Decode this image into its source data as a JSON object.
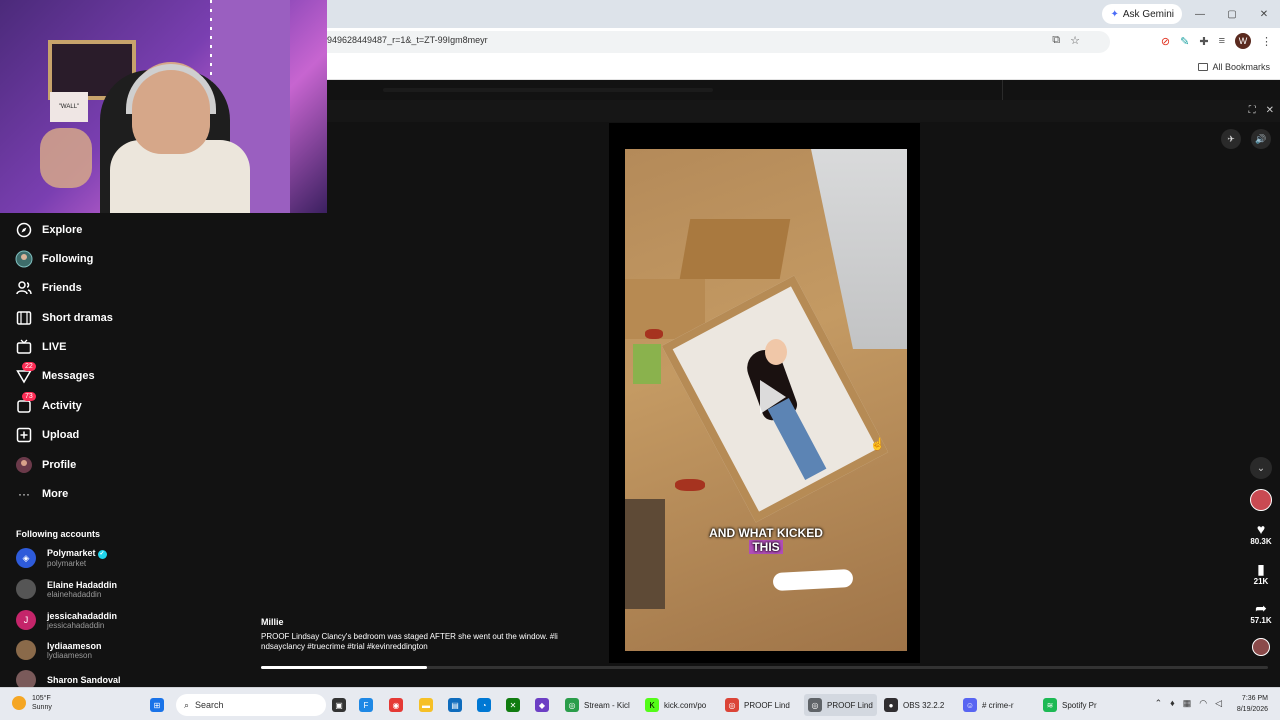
{
  "browser": {
    "ask_gemini": "Ask Gemini",
    "address": "949628449487_r=1&_t=ZT-99Igm8meyr",
    "all_bookmarks": "All Bookmarks",
    "profile_initial": "W"
  },
  "sidebar": {
    "nav": [
      {
        "label": "Explore"
      },
      {
        "label": "Following"
      },
      {
        "label": "Friends"
      },
      {
        "label": "Short dramas"
      },
      {
        "label": "LIVE"
      },
      {
        "label": "Messages",
        "badge": "22"
      },
      {
        "label": "Activity",
        "badge": "73"
      },
      {
        "label": "Upload"
      },
      {
        "label": "Profile"
      },
      {
        "label": "More"
      }
    ],
    "following_title": "Following accounts",
    "accounts": [
      {
        "name": "Polymarket",
        "handle": "polymarket",
        "color": "#2e5bda"
      },
      {
        "name": "Elaine Hadaddin",
        "handle": "elainehadaddin",
        "color": "#555555"
      },
      {
        "name": "jessicahadaddin",
        "handle": "jessicahadaddin",
        "color": "#c4256a",
        "initial": "J"
      },
      {
        "name": "lydiaameson",
        "handle": "lydiaameson",
        "color": "#8a6a4a"
      },
      {
        "name": "Sharon Sandoval",
        "handle": "",
        "color": "#7a5a5a"
      }
    ]
  },
  "video": {
    "caption_line1": "AND WHAT KICKED",
    "caption_line2": "THIS",
    "author": "Millie",
    "description": "PROOF Lindsay Clancy's bedroom was staged AFTER she went out the window. #li ndsayclancy #truecrime #trial #kevinreddington",
    "progress": 0.165
  },
  "actions": {
    "likes": "80.3K",
    "saves": "21K",
    "shares": "57.1K"
  },
  "webcam": {
    "poster_text": "\"WALL\""
  },
  "taskbar": {
    "temp": "105°F",
    "condition": "Sunny",
    "search": "Search",
    "apps": [
      {
        "label": "Stream - Kicl",
        "color": "#2a9d4a"
      },
      {
        "label": "kick.com/po",
        "color": "#53fc18"
      },
      {
        "label": "PROOF Lind",
        "color": "#db4437"
      },
      {
        "label": "PROOF Lind",
        "color": "#5f6368"
      },
      {
        "label": "OBS 32.2.2",
        "color": "#302e31"
      },
      {
        "label": "# crime-r",
        "color": "#5865f2"
      },
      {
        "label": "Spotify Pr",
        "color": "#1db954"
      }
    ],
    "time": "7:36 PM",
    "date": "8/19/2026"
  }
}
